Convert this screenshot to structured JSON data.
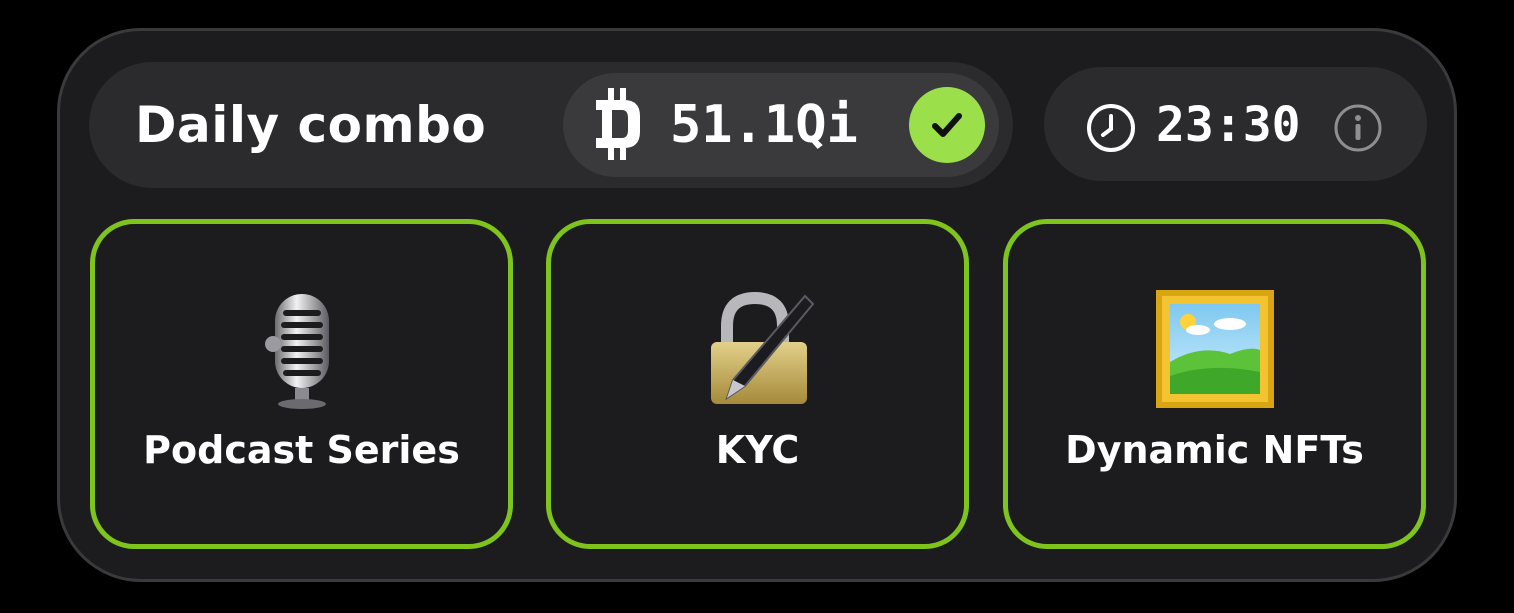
{
  "header": {
    "title": "Daily combo",
    "reward": {
      "icon": "coin-icon",
      "value": "51.1Qi",
      "status_icon": "check-icon"
    },
    "timer": {
      "icon": "clock-icon",
      "value": "23:30",
      "info_icon": "info-icon"
    }
  },
  "cards": [
    {
      "label": "Podcast Series",
      "icon": "microphone-icon"
    },
    {
      "label": "KYC",
      "icon": "lock-with-pen-icon"
    },
    {
      "label": "Dynamic NFTs",
      "icon": "framed-picture-icon"
    }
  ],
  "colors": {
    "background": "#000000",
    "panel": "#1c1c1e",
    "pill": "#2b2b2d",
    "accent_green": "#7fc41c",
    "check_green": "#9be04a",
    "text": "#ffffff"
  }
}
